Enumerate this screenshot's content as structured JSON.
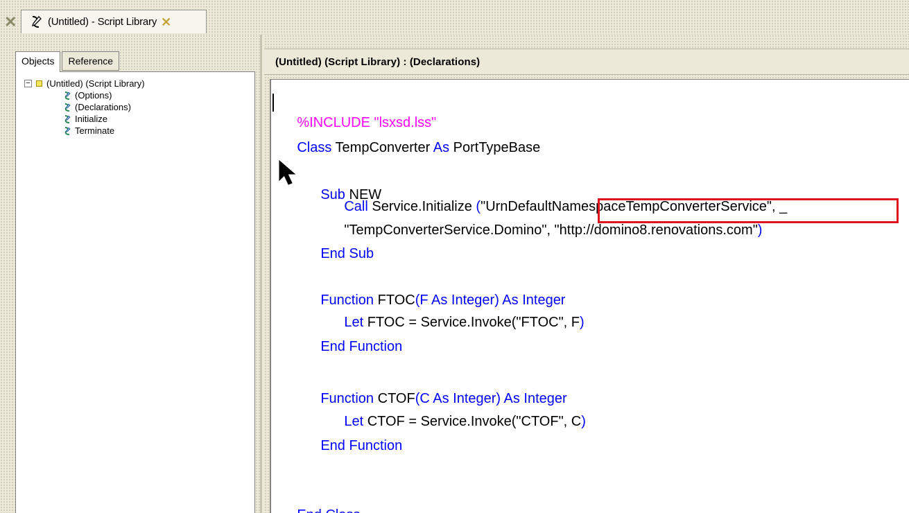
{
  "tab": {
    "label": "(Untitled) - Script Library"
  },
  "left_panel": {
    "tabs": [
      {
        "label": "Objects"
      },
      {
        "label": "Reference"
      }
    ],
    "tree": {
      "root": "(Untitled) (Script Library)",
      "children": [
        "(Options)",
        "(Declarations)",
        "Initialize",
        "Terminate"
      ]
    }
  },
  "editor": {
    "header": "(Untitled) (Script Library) : (Declarations)",
    "lines": {
      "l1_include": "%INCLUDE \"lsxsd.lss\"",
      "l2_kw_class": "Class",
      "l2_name": " TempConverter ",
      "l2_kw_as": "As",
      "l2_base": " PortTypeBase",
      "l3_kw_sub": "Sub",
      "l3_name": " NEW",
      "l4_kw_call": "Call",
      "l4_text": " Service.Initialize ",
      "l4_paren": "(",
      "l4_string": "\"UrnDefaultNamespaceTempConverterService\", _",
      "l5_text1": "\"TempConverterService.Domino\"",
      "l5_text2": ", \"http://domino8.renovations.com\"",
      "l5_paren": ")",
      "l6_end_sub": "End Sub",
      "l7_kw_function": "Function",
      "l7_name": " FTOC",
      "l7_sig": "(F As Integer) As Integer",
      "l8_kw_let": "Let",
      "l8_text": " FTOC = Service.Invoke(\"FTOC\", F",
      "l8_paren": ")",
      "l9_end_function": "End Function",
      "l10_kw_function": "Function",
      "l10_name": " CTOF",
      "l10_sig": "(C As Integer) As Integer",
      "l11_kw_let": "Let",
      "l11_text": " CTOF = Service.Invoke(\"CTOF\", C",
      "l11_paren": ")",
      "l12_end_function": "End Function",
      "l13_end_class": "End Class"
    }
  },
  "colors": {
    "keyword": "#0000ff",
    "directive": "#ff00ff",
    "highlight_border": "#e0141c"
  }
}
